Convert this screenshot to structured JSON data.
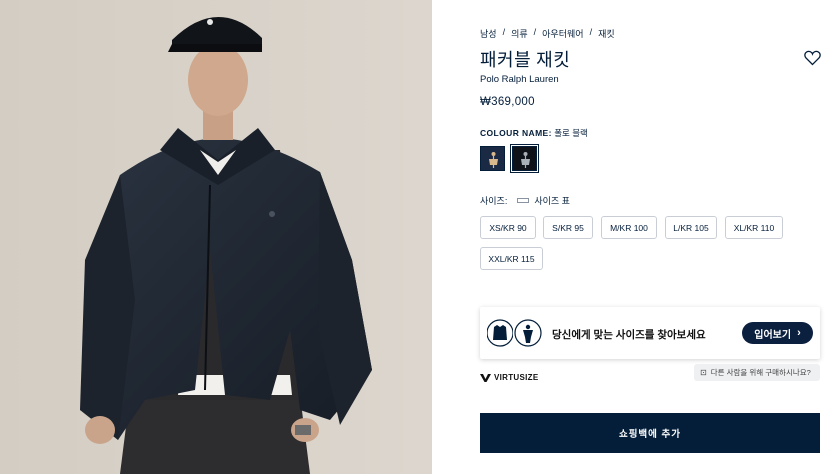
{
  "breadcrumb": {
    "items": [
      "남성",
      "의류",
      "아우터웨어",
      "재킷"
    ],
    "separator": "/"
  },
  "product": {
    "title": "패커블 재킷",
    "brand": "Polo Ralph Lauren",
    "price": "₩369,000",
    "image_icon": "product-photo"
  },
  "wishlist": {
    "icon": "heart-icon"
  },
  "colour": {
    "label": "COLOUR NAME:",
    "selected": "폴로 블랙",
    "swatches": [
      {
        "name": "navy",
        "color": "#1b2a44",
        "selected": false
      },
      {
        "name": "폴로 블랙",
        "color": "#0f1319",
        "selected": true
      }
    ]
  },
  "size": {
    "label": "사이즈:",
    "guide_label": "사이즈 표",
    "options": [
      "XS/KR 90",
      "S/KR 95",
      "M/KR 100",
      "L/KR 105",
      "XL/KR 110",
      "XXL/KR 115"
    ]
  },
  "virtusize": {
    "prompt": "당신에게 맞는 사이즈를 찾아보세요",
    "button": "입어보기",
    "logo": "VIRTUSIZE",
    "privacy": "다른 사람을 위해 구매하시나요?"
  },
  "cart": {
    "button": "쇼핑백에 추가"
  },
  "colors": {
    "navy": "#041e3a",
    "button_dark": "#0b1f3f",
    "border": "#c9ced6",
    "photo_bg": "#d8d2c9"
  }
}
